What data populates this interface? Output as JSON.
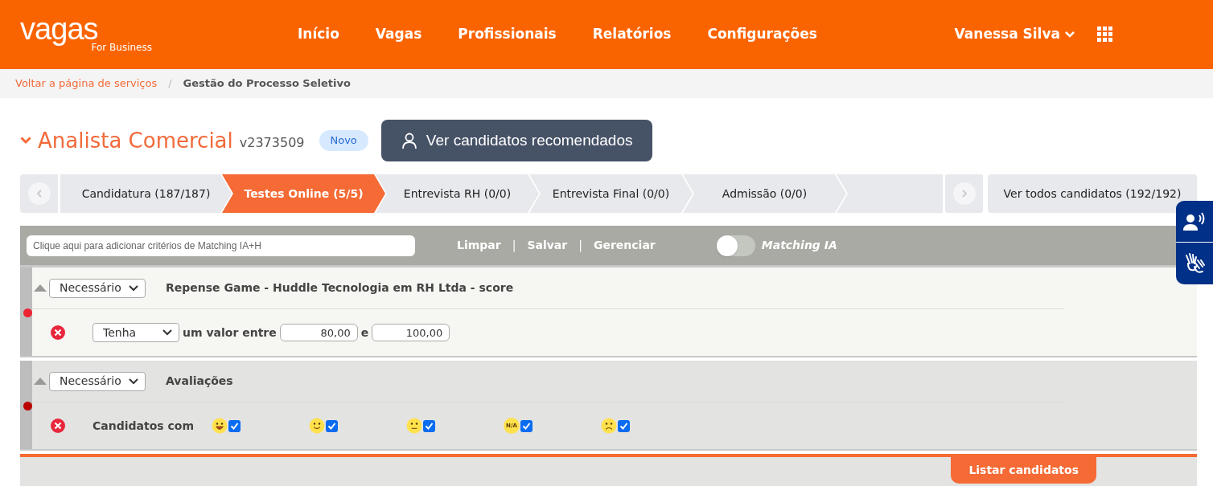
{
  "header": {
    "logo": "vagas",
    "logo_sub": "For Business",
    "nav": [
      {
        "label": "Início"
      },
      {
        "label": "Vagas"
      },
      {
        "label": "Profissionais"
      },
      {
        "label": "Relatórios"
      },
      {
        "label": "Configurações"
      }
    ],
    "user": "Vanessa Silva"
  },
  "breadcrumb": [
    {
      "label": "Voltar a página de serviços",
      "kind": "link"
    },
    {
      "label": "/",
      "kind": "sep"
    },
    {
      "label": "Gestão do Processo Seletivo",
      "kind": "current"
    }
  ],
  "job": {
    "title": "Analista Comercial",
    "code": "v2373509",
    "badge": "Novo",
    "recommended_button": "Ver candidatos recomendados"
  },
  "stages": [
    {
      "label": "Candidatura (187/187)",
      "selected": false
    },
    {
      "label": "Testes Online (5/5)",
      "selected": true
    },
    {
      "label": "Entrevista RH (0/0)",
      "selected": false
    },
    {
      "label": "Entrevista Final (0/0)",
      "selected": false
    },
    {
      "label": "Admissão (0/0)",
      "selected": false
    }
  ],
  "all_candidates": "Ver todos candidatos (192/192)",
  "toolbar": {
    "placeholder": "Clique aqui para adicionar critérios de Matching IA+H",
    "links": [
      {
        "label": "Limpar"
      },
      {
        "label": "Salvar"
      },
      {
        "label": "Gerenciar"
      }
    ],
    "separator": "|",
    "toggle": {
      "label": "Matching IA",
      "on": false
    }
  },
  "criteria": [
    {
      "kind": "range",
      "requirement": "Necessário",
      "title": "Repense Game - Huddle Tecnologia em RH Ltda - score",
      "condition": "Tenha",
      "between": "um valor entre",
      "min": "80,00",
      "and": "e",
      "max": "100,00",
      "color": "#ee2233"
    },
    {
      "kind": "ratings",
      "requirement": "Necessário",
      "title": "Avaliações",
      "prefix": "Candidatos com",
      "color": "#bb0000",
      "ratings": [
        {
          "kind": "grin",
          "checked": true
        },
        {
          "kind": "smile",
          "checked": true
        },
        {
          "kind": "neutral",
          "checked": true
        },
        {
          "kind": "na",
          "text": "N/A",
          "checked": true
        },
        {
          "kind": "sad",
          "checked": true
        }
      ]
    }
  ],
  "list_button": "Listar candidatos"
}
